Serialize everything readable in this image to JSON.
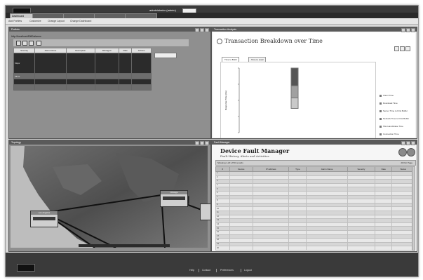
{
  "header": {
    "logo": "",
    "user_line": "administrator (admin)",
    "role_label": "Role",
    "role_value": "",
    "tabs": [
      {
        "label": "Dashboard",
        "active": true
      },
      {
        "label": ""
      },
      {
        "label": ""
      },
      {
        "label": ""
      },
      {
        "label": ""
      }
    ]
  },
  "toolbar": {
    "items": [
      "Add Portlets",
      "Customize",
      "Change Layout",
      "Change Dashboard"
    ]
  },
  "portlet_list": {
    "title": "Portlets",
    "url": "http://localhost:8080/alarms",
    "columns": [
      "Severity",
      "Alarm Name",
      "Description",
      "Managed",
      "Date",
      "Actions"
    ],
    "rows": [
      {
        "severity": "Major",
        "name": "",
        "description": "",
        "managed": "",
        "date": "",
        "actions": ""
      },
      {
        "severity": "Minor",
        "name": "",
        "description": "",
        "managed": "",
        "date": "",
        "actions": ""
      },
      {
        "severity": "",
        "name": "",
        "description": "",
        "managed": "",
        "date": "",
        "actions": ""
      },
      {
        "severity": "",
        "name": "",
        "description": "",
        "managed": "",
        "date": "",
        "actions": ""
      }
    ]
  },
  "chart_portlet": {
    "title": "Transaction Analysis",
    "heading": "Transaction Breakdown over Time",
    "header_info": "",
    "tabs": [
      "Time to Build",
      "Time to Load"
    ],
    "ylabel": "Response Time (ms)",
    "legend": [
      "Client Time",
      "Download Time",
      "Server Time to First Buffer",
      "Network Time to First Buffer",
      "SSL Handshake Time",
      "Connection Time",
      "DNS Time",
      "Retry Time"
    ]
  },
  "chart_data": {
    "type": "bar",
    "categories": [
      ""
    ],
    "series": [
      {
        "name": "Retry Time",
        "values": [
          220
        ]
      },
      {
        "name": "DNS Time",
        "values": [
          150
        ]
      },
      {
        "name": "Connection Time",
        "values": [
          130
        ]
      }
    ],
    "ylim": [
      0,
      800
    ],
    "yticks": [
      "",
      "",
      "",
      "",
      ""
    ],
    "ylabel": "Response Time (ms)"
  },
  "map_panel": {
    "title": "Topology",
    "boxes": [
      "Los Angeles",
      "Chicago",
      ""
    ]
  },
  "fault_manager": {
    "panel_title": "Fault Manager",
    "title": "Device Fault Manager",
    "subtitle": "Fault History, Alerts and Activities",
    "bar_left": "Showing 1-20 of 50 records",
    "bar_right": "20 Per Page",
    "columns": [
      "#",
      "Device",
      "IP Address",
      "Type",
      "Alarm Name",
      "Severity",
      "Date",
      "Status"
    ],
    "rows": [
      [
        "1",
        "",
        "",
        "",
        "",
        "",
        "",
        ""
      ],
      [
        "2",
        "",
        "",
        "",
        "",
        "",
        "",
        ""
      ],
      [
        "3",
        "",
        "",
        "",
        "",
        "",
        "",
        ""
      ],
      [
        "4",
        "",
        "",
        "",
        "",
        "",
        "",
        ""
      ],
      [
        "5",
        "",
        "",
        "",
        "",
        "",
        "",
        ""
      ],
      [
        "6",
        "",
        "",
        "",
        "",
        "",
        "",
        ""
      ],
      [
        "7",
        "",
        "",
        "",
        "",
        "",
        "",
        ""
      ],
      [
        "8",
        "",
        "",
        "",
        "",
        "",
        "",
        ""
      ],
      [
        "9",
        "",
        "",
        "",
        "",
        "",
        "",
        ""
      ],
      [
        "10",
        "",
        "",
        "",
        "",
        "",
        "",
        ""
      ],
      [
        "11",
        "",
        "",
        "",
        "",
        "",
        "",
        ""
      ],
      [
        "12",
        "",
        "",
        "",
        "",
        "",
        "",
        ""
      ],
      [
        "13",
        "",
        "",
        "",
        "",
        "",
        "",
        ""
      ],
      [
        "14",
        "",
        "",
        "",
        "",
        "",
        "",
        ""
      ],
      [
        "15",
        "",
        "",
        "",
        "",
        "",
        "",
        ""
      ],
      [
        "16",
        "",
        "",
        "",
        "",
        "",
        "",
        ""
      ],
      [
        "17",
        "",
        "",
        "",
        "",
        "",
        "",
        ""
      ],
      [
        "18",
        "",
        "",
        "",
        "",
        "",
        "",
        ""
      ],
      [
        "19",
        "",
        "",
        "",
        "",
        "",
        "",
        ""
      ],
      [
        "20",
        "",
        "",
        "",
        "",
        "",
        "",
        ""
      ]
    ]
  },
  "footer": {
    "logo": "",
    "links": [
      "Help",
      "Contact",
      "Preferences",
      "Logout"
    ]
  }
}
